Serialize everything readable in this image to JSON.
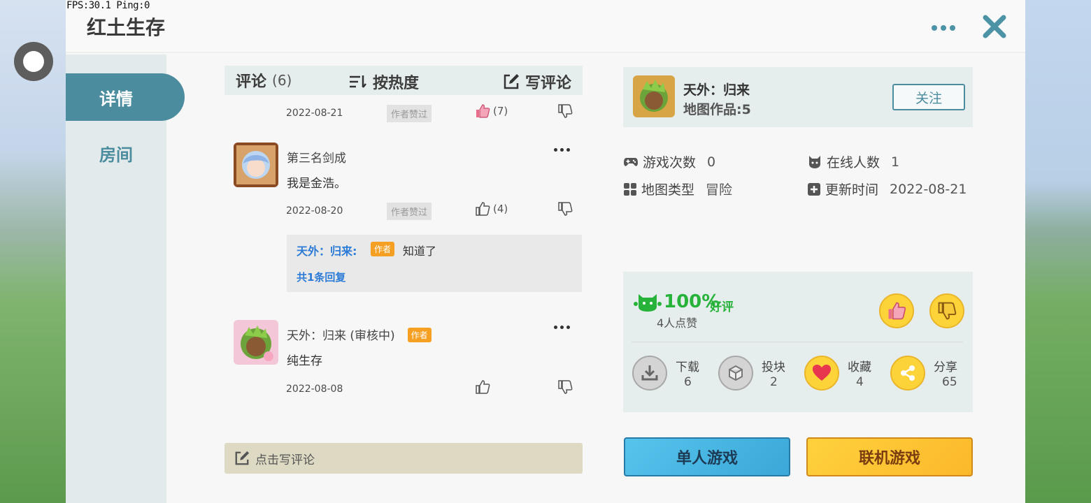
{
  "overlay": {
    "fps_text": "FPS:30.1  Ping:0"
  },
  "header": {
    "title": "红土生存"
  },
  "sidebar": {
    "tabs": [
      {
        "label": "详情"
      },
      {
        "label": "房间"
      }
    ]
  },
  "comments": {
    "title": "评论",
    "count": "(6)",
    "sort_label": "按热度",
    "write_label": "写评论",
    "rows": [
      {
        "date": "2022-08-21",
        "badge": "作者赞过",
        "likes": "(7)"
      },
      {
        "name": "第三名剑成",
        "text": "我是金浩。",
        "date": "2022-08-20",
        "badge": "作者赞过",
        "likes": "(4)",
        "reply": {
          "name": "天外：归来:",
          "tag": "作者",
          "text": "知道了",
          "count": "共1条回复"
        }
      },
      {
        "name": "天外：归来  (审核中)",
        "tag": "作者",
        "text": "纯生存",
        "date": "2022-08-08"
      }
    ],
    "write_bar": "点击写评论"
  },
  "author": {
    "name": "天外：归来",
    "works": "地图作品:5",
    "follow": "关注"
  },
  "stats": {
    "plays_label": "游戏次数",
    "plays": "0",
    "online_label": "在线人数",
    "online": "1",
    "type_label": "地图类型",
    "type": "冒险",
    "updated_label": "更新时间",
    "updated": "2022-08-21"
  },
  "rating": {
    "percent": "100%",
    "word": "好评",
    "likes_text": "4人点赞",
    "actions": [
      {
        "label": "下载",
        "value": "6"
      },
      {
        "label": "投块",
        "value": "2"
      },
      {
        "label": "收藏",
        "value": "4"
      },
      {
        "label": "分享",
        "value": "65"
      }
    ]
  },
  "buttons": {
    "single": "单人游戏",
    "multi": "联机游戏"
  },
  "colors": {
    "accent": "#4b8c9e",
    "positive": "#27b33a",
    "author_tag": "#f5a023",
    "link": "#2c7bd6"
  }
}
